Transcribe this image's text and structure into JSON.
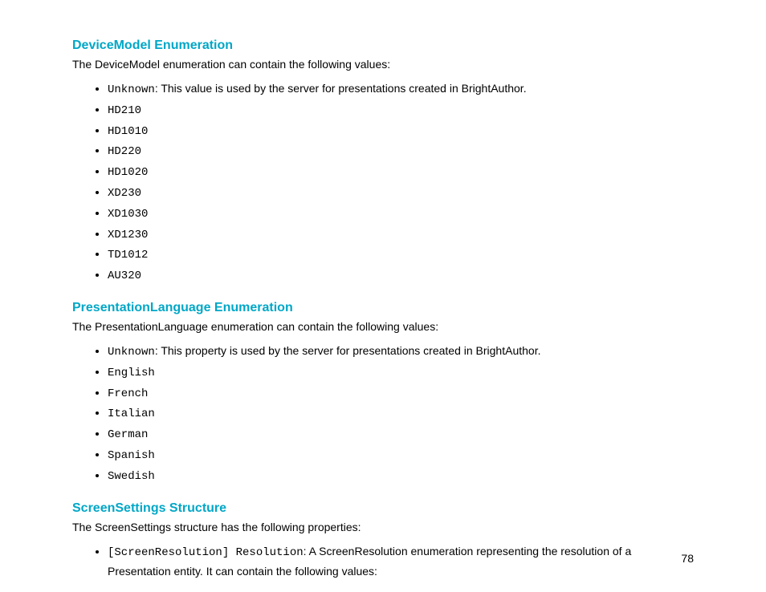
{
  "page_number": "78",
  "sections": [
    {
      "heading": "DeviceModel Enumeration",
      "intro": "The DeviceModel enumeration can contain the following values:",
      "items": [
        {
          "code": "Unknown",
          "desc": ": This value is used by the server for presentations created in BrightAuthor."
        },
        {
          "code": "HD210"
        },
        {
          "code": "HD1010"
        },
        {
          "code": "HD220"
        },
        {
          "code": "HD1020"
        },
        {
          "code": "XD230"
        },
        {
          "code": "XD1030"
        },
        {
          "code": "XD1230"
        },
        {
          "code": "TD1012"
        },
        {
          "code": "AU320"
        }
      ]
    },
    {
      "heading": "PresentationLanguage Enumeration",
      "intro": "The PresentationLanguage enumeration can contain the following values:",
      "items": [
        {
          "code": "Unknown",
          "desc": ": This property is used by the server for presentations created in BrightAuthor."
        },
        {
          "code": "English"
        },
        {
          "code": "French"
        },
        {
          "code": "Italian"
        },
        {
          "code": "German"
        },
        {
          "code": "Spanish"
        },
        {
          "code": "Swedish"
        }
      ]
    },
    {
      "heading": "ScreenSettings Structure",
      "intro": "The ScreenSettings structure has the following properties:",
      "items": [
        {
          "code": "[ScreenResolution] Resolution",
          "desc": ": A ScreenResolution enumeration representing the resolution of a Presentation entity. It can contain the following values:"
        }
      ]
    }
  ]
}
